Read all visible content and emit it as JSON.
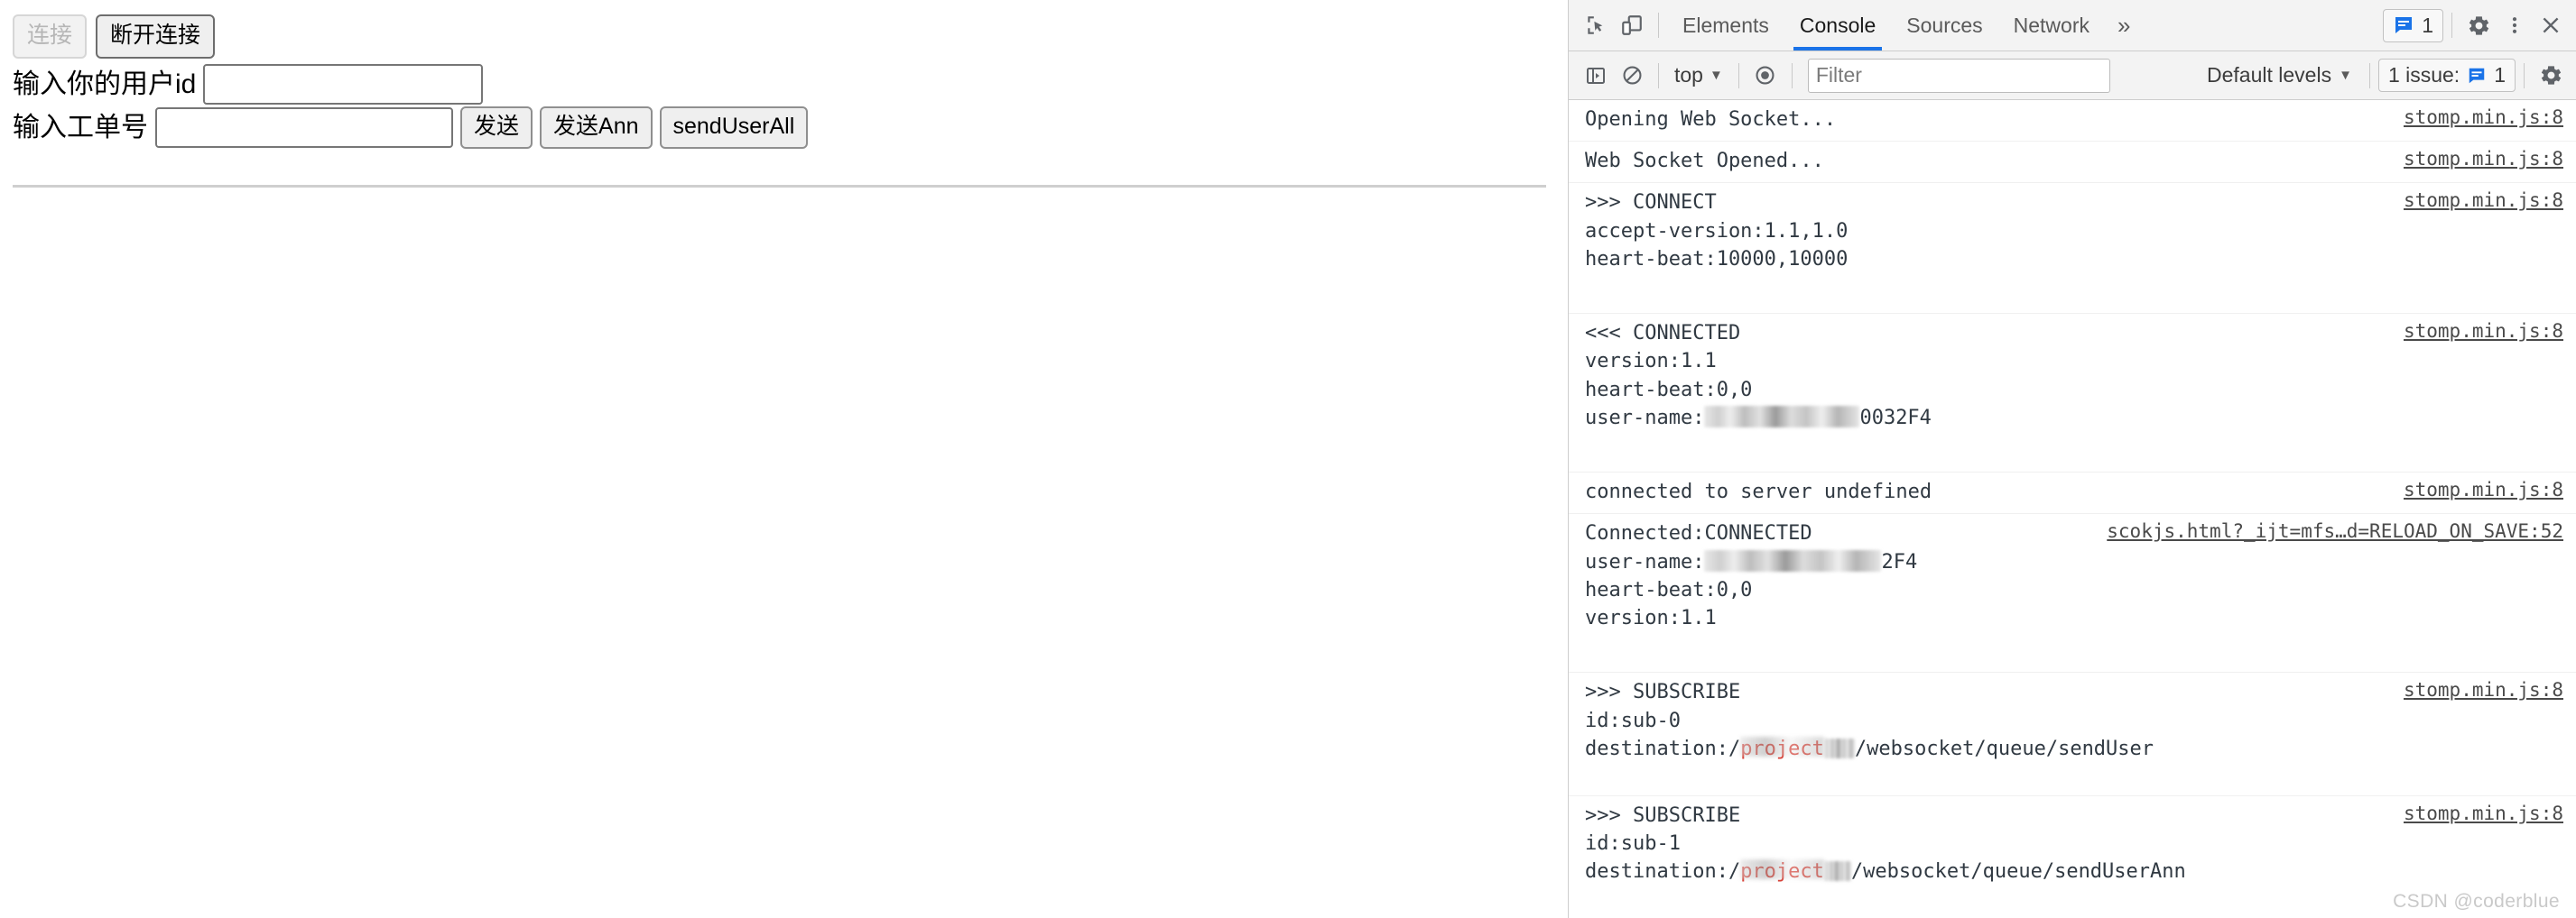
{
  "page": {
    "connect_button": "连接",
    "disconnect_button": "断开连接",
    "user_id_label": "输入你的用户id",
    "user_id_value": "",
    "ticket_label": "输入工单号",
    "ticket_value": "",
    "send_button": "发送",
    "send_ann_button": "发送Ann",
    "send_user_all_button": "sendUserAll"
  },
  "devtools": {
    "tabs": [
      {
        "label": "Elements",
        "active": false
      },
      {
        "label": "Console",
        "active": true
      },
      {
        "label": "Sources",
        "active": false
      },
      {
        "label": "Network",
        "active": false
      }
    ],
    "more_tabs_glyph": "»",
    "icons": {
      "inspect": "inspect-element-icon",
      "device": "device-toolbar-icon",
      "settings": "gear-icon",
      "kebab": "more-options-icon",
      "close": "close-icon",
      "message_badge": "message-badge-icon"
    },
    "message_badge_count": "1",
    "filterbar": {
      "sidebar_toggle": "console-sidebar-icon",
      "clear_console": "clear-console-icon",
      "context": "top",
      "eye": "live-expression-icon",
      "filter_placeholder": "Filter",
      "filter_value": "",
      "levels": "Default levels",
      "issues_label": "1 issue:",
      "issues_count": "1",
      "settings": "gear-icon"
    }
  },
  "console": {
    "messages": [
      {
        "lines": [
          "Opening Web Socket..."
        ],
        "source": "stomp.min.js:8",
        "extra": ""
      },
      {
        "lines": [
          "Web Socket Opened..."
        ],
        "source": "stomp.min.js:8",
        "extra": ""
      },
      {
        "lines": [
          ">>> CONNECT",
          "accept-version:1.1,1.0",
          "heart-beat:10000,10000"
        ],
        "source": "stomp.min.js:8",
        "extra": "tall"
      },
      {
        "lines": [
          "<<< CONNECTED",
          "version:1.1",
          "heart-beat:0,0",
          "user-name:"
        ],
        "redacted_suffix": "0032F4",
        "source": "stomp.min.js:8",
        "extra": "tall"
      },
      {
        "lines": [
          "connected to server undefined"
        ],
        "source": "stomp.min.js:8",
        "extra": ""
      },
      {
        "lines": [
          "Connected:CONNECTED",
          "user-name:",
          "heart-beat:0,0",
          "version:1.1"
        ],
        "redacted_suffix": "2F4",
        "source": "scokjs.html?_ijt=mfs…d=RELOAD_ON_SAVE:52",
        "extra": "tall"
      },
      {
        "lines": [
          ">>> SUBSCRIBE",
          "id:sub-0",
          "destination:/"
        ],
        "spell_word": "project",
        "path_suffix": "/websocket/queue/sendUser",
        "source": "stomp.min.js:8",
        "extra": "tall2"
      },
      {
        "lines": [
          ">>> SUBSCRIBE",
          "id:sub-1",
          "destination:/"
        ],
        "spell_word": "project",
        "path_suffix": "/websocket/queue/sendUserAnn",
        "source": "stomp.min.js:8",
        "extra": "tall2"
      }
    ]
  },
  "watermark": "CSDN @coderblue",
  "colors": {
    "accent": "#1a73e8",
    "spell_error": "#d93025",
    "console_text": "#303942",
    "toolbar_bg": "#f3f3f3"
  }
}
